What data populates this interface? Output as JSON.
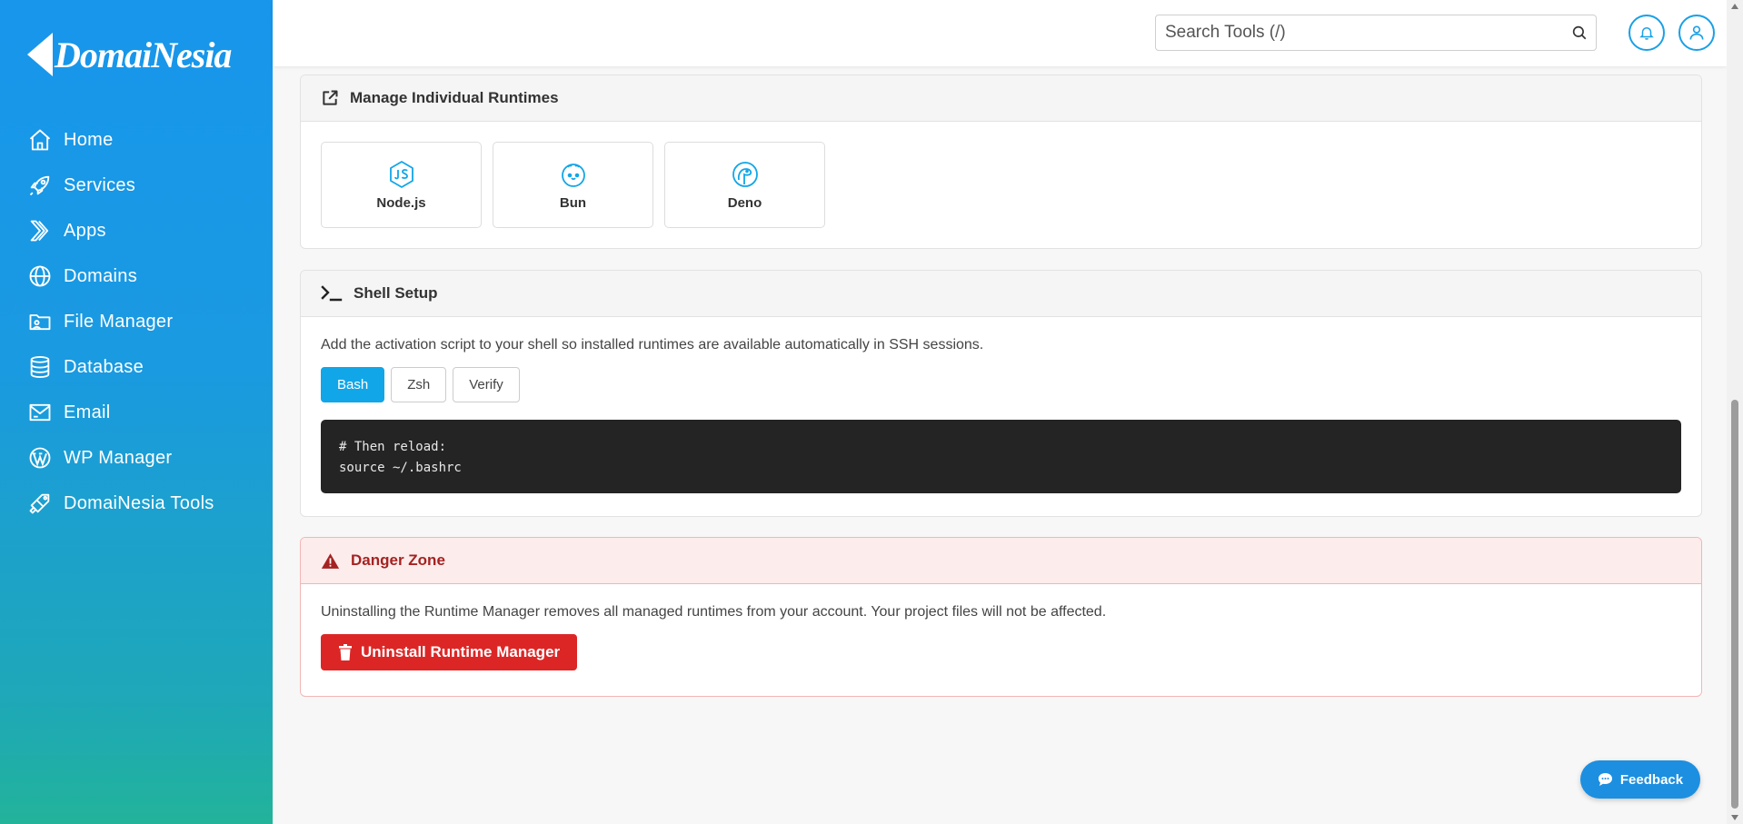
{
  "brand": {
    "name": "DomaiNesia"
  },
  "sidebar": {
    "items": [
      {
        "label": "Home",
        "icon": "home-icon"
      },
      {
        "label": "Services",
        "icon": "rocket-icon"
      },
      {
        "label": "Apps",
        "icon": "apps-icon"
      },
      {
        "label": "Domains",
        "icon": "globe-icon"
      },
      {
        "label": "File Manager",
        "icon": "folder-icon"
      },
      {
        "label": "Database",
        "icon": "database-icon"
      },
      {
        "label": "Email",
        "icon": "email-icon"
      },
      {
        "label": "WP Manager",
        "icon": "wordpress-icon"
      },
      {
        "label": "DomaiNesia Tools",
        "icon": "tools-icon"
      }
    ]
  },
  "header": {
    "search_placeholder": "Search Tools (/)"
  },
  "runtimes": {
    "title": "Manage Individual Runtimes",
    "items": [
      {
        "label": "Node.js",
        "icon": "nodejs-icon"
      },
      {
        "label": "Bun",
        "icon": "bun-icon"
      },
      {
        "label": "Deno",
        "icon": "deno-icon"
      }
    ]
  },
  "shell": {
    "title": "Shell Setup",
    "description": "Add the activation script to your shell so installed runtimes are available automatically in SSH sessions.",
    "tabs": [
      {
        "label": "Bash",
        "active": true
      },
      {
        "label": "Zsh",
        "active": false
      },
      {
        "label": "Verify",
        "active": false
      }
    ],
    "code_lines": [
      "# Then reload:",
      "source ~/.bashrc"
    ]
  },
  "danger": {
    "title": "Danger Zone",
    "description": "Uninstalling the Runtime Manager removes all managed runtimes from your account. Your project files will not be affected.",
    "button_label": "Uninstall Runtime Manager"
  },
  "feedback": {
    "label": "Feedback"
  },
  "colors": {
    "accent": "#11a6e8",
    "danger": "#dc2626",
    "sidebar_top": "#1796ec",
    "sidebar_bottom": "#22b39a"
  }
}
